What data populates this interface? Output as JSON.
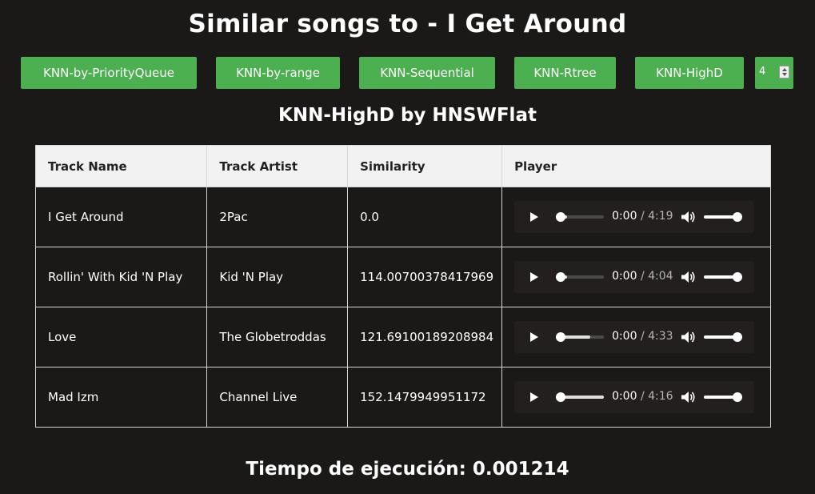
{
  "page": {
    "title": "Similar songs to - I Get Around",
    "subtitle": "KNN-HighD by HNSWFlat",
    "footer": "Tiempo de ejecución: 0.001214"
  },
  "toolbar": {
    "buttons": [
      {
        "label": "KNN-by-PriorityQueue"
      },
      {
        "label": "KNN-by-range"
      },
      {
        "label": "KNN-Sequential"
      },
      {
        "label": "KNN-Rtree"
      },
      {
        "label": "KNN-HighD"
      }
    ],
    "k_value": "4"
  },
  "table": {
    "headers": [
      "Track Name",
      "Track Artist",
      "Similarity",
      "Player"
    ],
    "rows": [
      {
        "name": "I Get Around",
        "artist": "2Pac",
        "similarity": "0.0",
        "current": "0:00",
        "duration": "/ 4:19",
        "buffered": 0.2
      },
      {
        "name": "Rollin' With Kid 'N Play",
        "artist": "Kid 'N Play",
        "similarity": "114.00700378417969",
        "current": "0:00",
        "duration": "/ 4:04",
        "buffered": 0.2
      },
      {
        "name": "Love",
        "artist": "The Globetroddas",
        "similarity": "121.69100189208984",
        "current": "0:00",
        "duration": "/ 4:33",
        "buffered": 0.7
      },
      {
        "name": "Mad Izm",
        "artist": "Channel Live",
        "similarity": "152.1479949951172",
        "current": "0:00",
        "duration": "/ 4:16",
        "buffered": 1.0
      }
    ]
  },
  "colors": {
    "background": "#1b1918",
    "accent_button": "#4caf50",
    "header_bg": "#f2f2f2"
  },
  "icons": {
    "play": "play-icon",
    "volume": "volume-icon",
    "spinner": "spin-button-icon"
  }
}
